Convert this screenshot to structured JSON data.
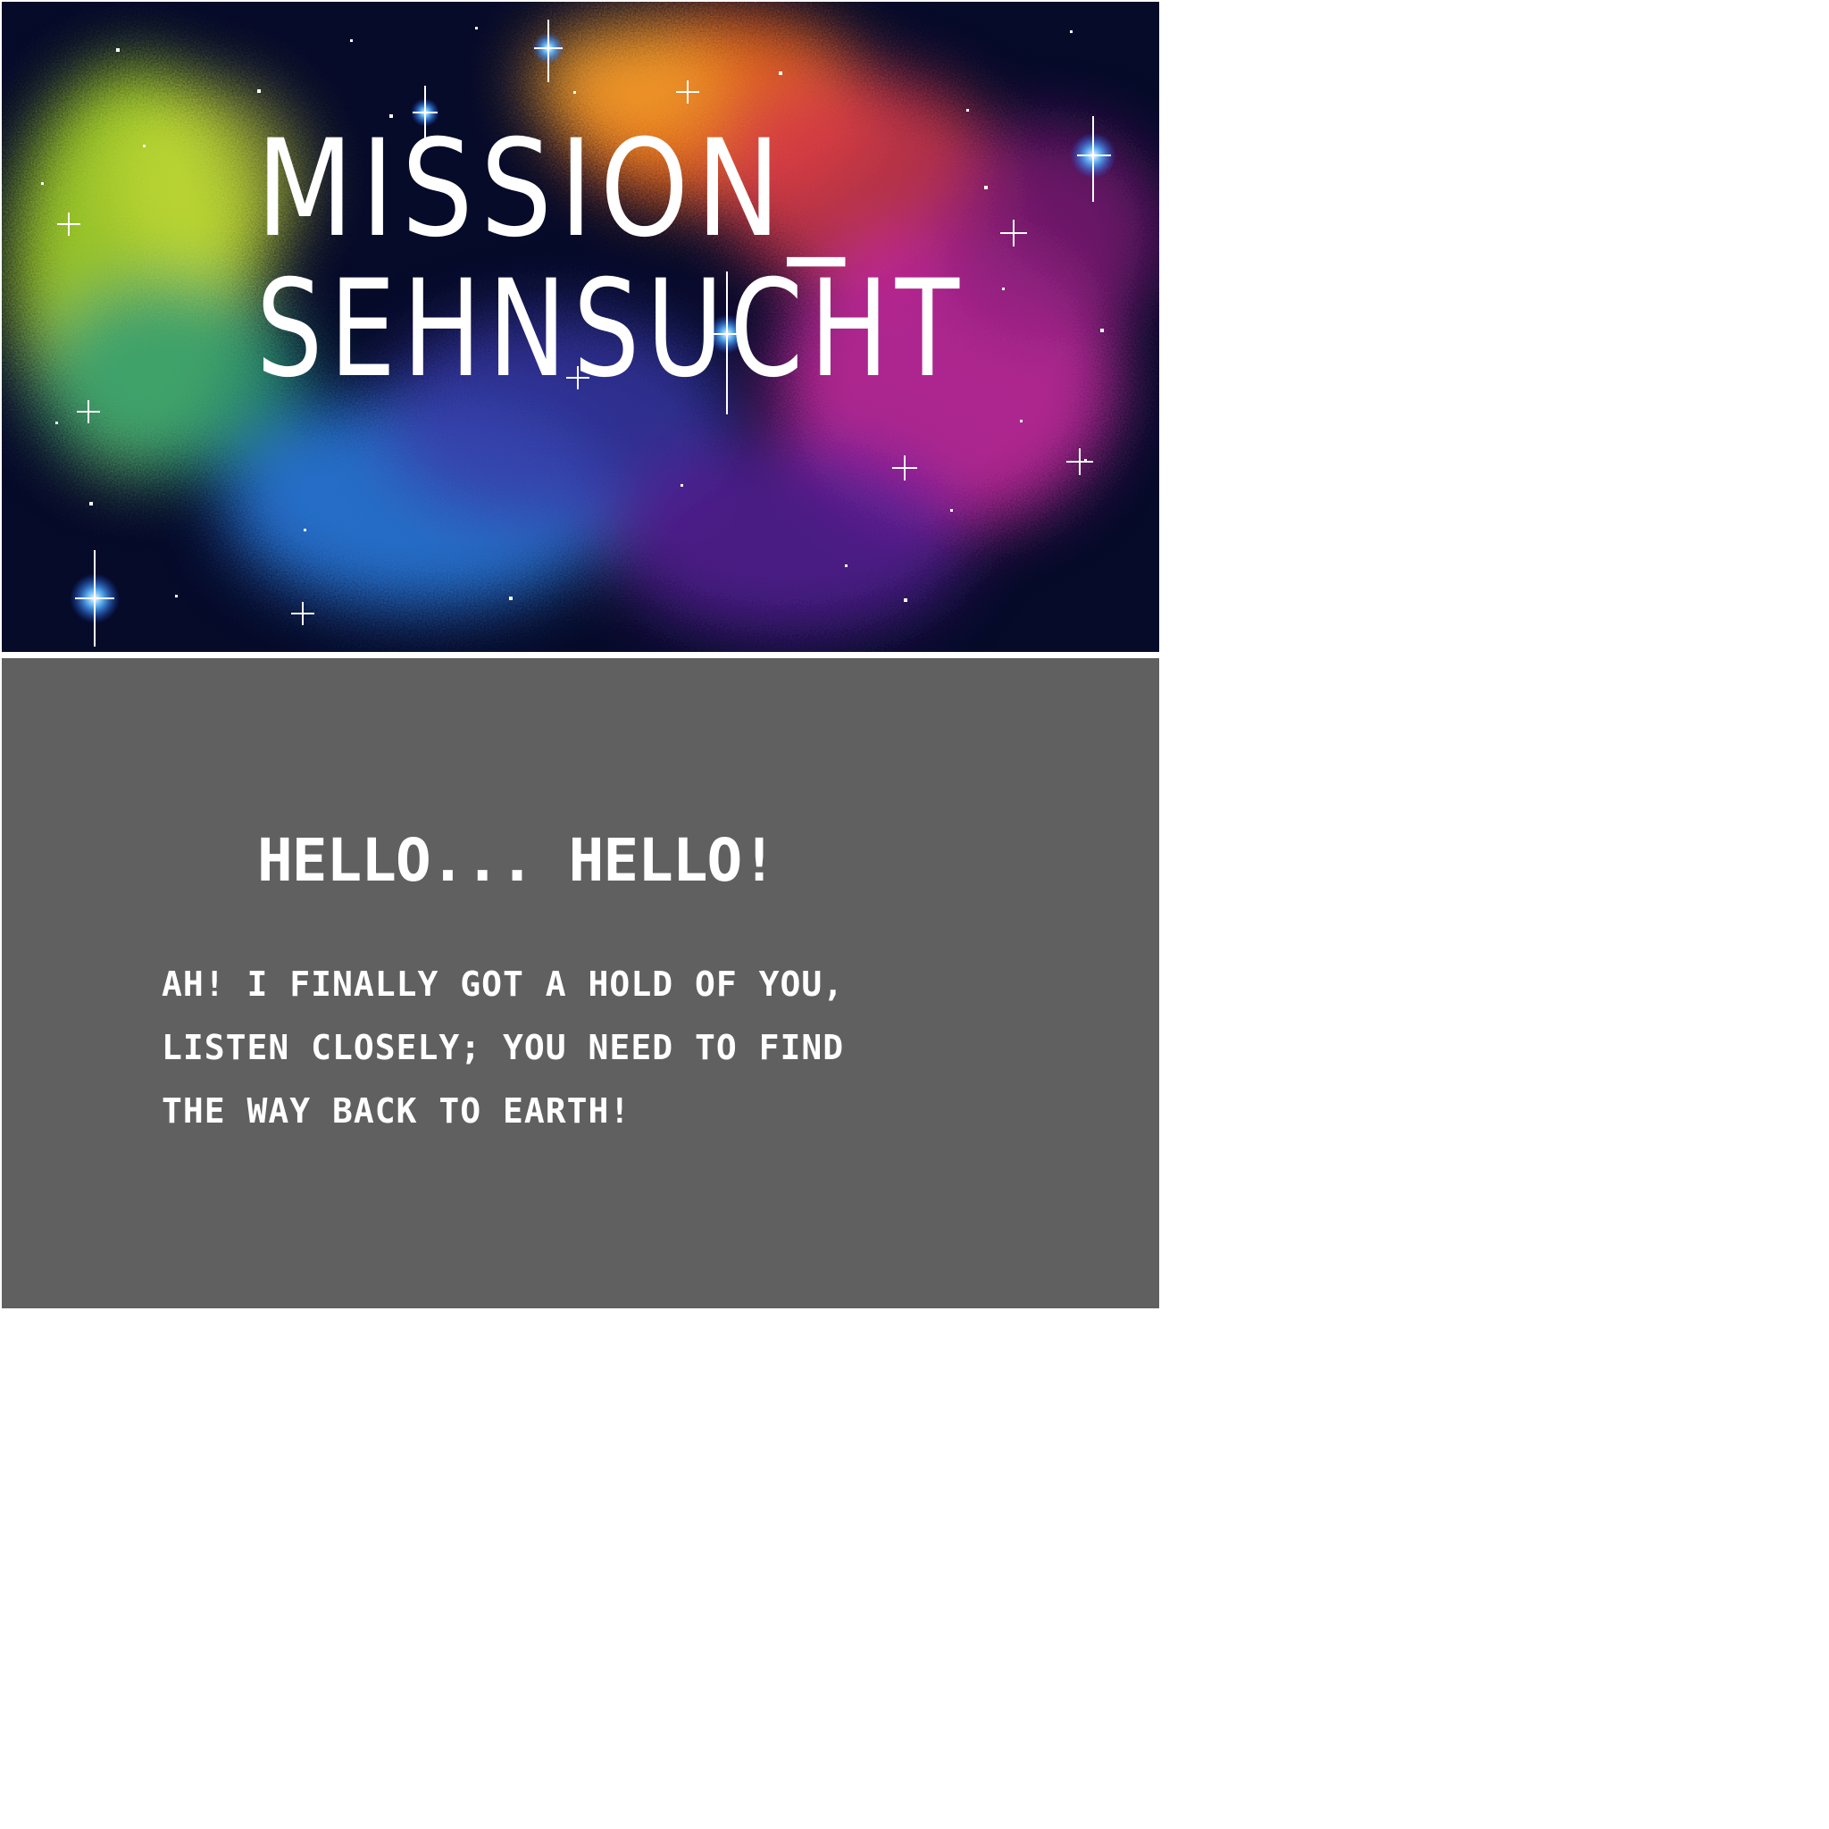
{
  "title_screen": {
    "title_line_1": "MISSION_",
    "title_line_2": "SEHNSUCHT"
  },
  "dialog_screen": {
    "heading": "HELLO... HELLO!",
    "lines": [
      "AH! I FINALLY GOT A HOLD OF YOU,",
      "LISTEN CLOSELY; YOU NEED TO FIND",
      "THE WAY BACK TO EARTH!"
    ]
  },
  "colors": {
    "space_background": "#070b2a",
    "nebula_green": "#a6d628",
    "nebula_orange": "#e8641c",
    "nebula_magenta": "#c0289a",
    "nebula_blue": "#2a78d8",
    "dialog_background": "#606060",
    "text": "#ffffff"
  }
}
